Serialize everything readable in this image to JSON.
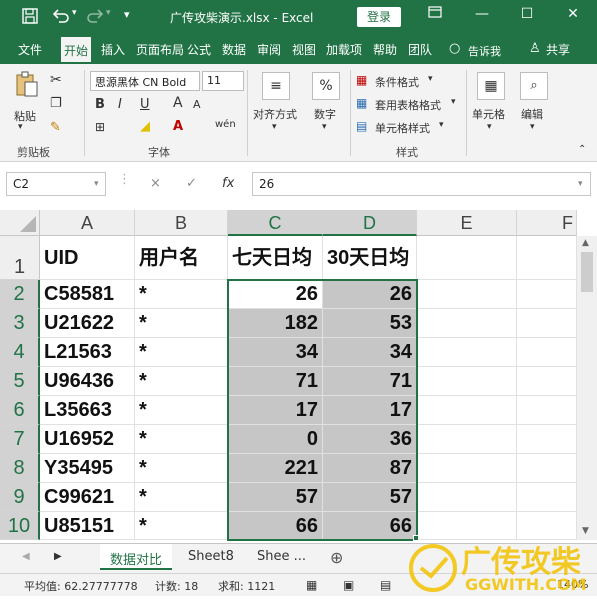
{
  "titlebar": {
    "save_icon": "save-icon",
    "undo_icon": "undo-icon",
    "redo_icon": "redo-icon",
    "customize_icon": "customize-qat-icon",
    "title": "广传攻柴演示.xlsx  -  Excel",
    "login_label": "登录",
    "ribbon_display_icon": "ribbon-display-icon",
    "min_icon": "minimize-icon",
    "max_icon": "maximize-icon",
    "close_icon": "close-icon"
  },
  "tabs": [
    {
      "label": "文件"
    },
    {
      "label": "开始"
    },
    {
      "label": "插入"
    },
    {
      "label": "页面布局"
    },
    {
      "label": "公式"
    },
    {
      "label": "数据"
    },
    {
      "label": "审阅"
    },
    {
      "label": "视图"
    },
    {
      "label": "加载项"
    },
    {
      "label": "帮助"
    },
    {
      "label": "团队"
    },
    {
      "label": "告诉我"
    },
    {
      "label": "共享"
    }
  ],
  "ribbon": {
    "clipboard": {
      "paste_label": "粘贴",
      "group_label": "剪贴板"
    },
    "font": {
      "font_name": "思源黑体 CN Bold",
      "font_size": "11",
      "group_label": "字体",
      "bold": "B",
      "italic": "I",
      "underline": "U",
      "grow": "A",
      "shrink": "A",
      "phonetic": "wén"
    },
    "align": {
      "label": "对齐方式"
    },
    "number": {
      "label": "数字",
      "percent": "%"
    },
    "styles": {
      "conditional": "条件格式",
      "table": "套用表格格式",
      "cell": "单元格样式",
      "group_label": "样式"
    },
    "cells": {
      "label": "单元格"
    },
    "edit": {
      "label": "编辑"
    }
  },
  "formula": {
    "name_box": "C2",
    "cancel": "×",
    "enter": "✓",
    "fx": "fx",
    "value": "26"
  },
  "columns": [
    "A",
    "B",
    "C",
    "D",
    "E",
    "F"
  ],
  "rows": [
    "1",
    "2",
    "3",
    "4",
    "5",
    "6",
    "7",
    "8",
    "9",
    "10"
  ],
  "table": {
    "headers": [
      "UID",
      "用户名",
      "七天日均",
      "30天日均"
    ],
    "data": [
      [
        "C58581",
        "*",
        "26",
        "26"
      ],
      [
        "U21622",
        "*",
        "182",
        "53"
      ],
      [
        "L21563",
        "*",
        "34",
        "34"
      ],
      [
        "U96436",
        "*",
        "71",
        "71"
      ],
      [
        "L35663",
        "*",
        "17",
        "17"
      ],
      [
        "U16952",
        "*",
        "0",
        "36"
      ],
      [
        "Y35495",
        "*",
        "221",
        "87"
      ],
      [
        "C99621",
        "*",
        "57",
        "57"
      ],
      [
        "U85151",
        "*",
        "66",
        "66"
      ]
    ]
  },
  "sheets": [
    "数据对比",
    "Sheet8",
    "Shee ..."
  ],
  "status": {
    "average": "平均值: 62.27777778",
    "count": "计数: 18",
    "sum": "求和: 1121",
    "zoom": "140%"
  },
  "watermark": {
    "text": "广传攻柴",
    "url": "GGWITH.COM"
  },
  "colors": {
    "brand": "#217346",
    "highlight": "#c6c6c6"
  }
}
